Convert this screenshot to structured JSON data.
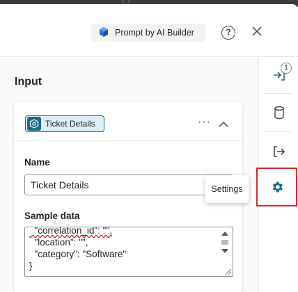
{
  "header": {
    "chip_label": "Prompt by AI Builder",
    "help_label": "?"
  },
  "content": {
    "section_title": "Input",
    "card": {
      "tag_label": "Ticket Details",
      "more_label": "···",
      "name_label": "Name",
      "name_value": "Ticket Details",
      "sample_label": "Sample data",
      "sample_lines": [
        "  \"correlation_id\": \"\",",
        "  \"location\": \"\",",
        "  \"category\": \"Software\"",
        "}"
      ]
    }
  },
  "rail": {
    "badge_count": "1",
    "items": [
      {
        "icon": "input-arrow-icon"
      },
      {
        "icon": "database-icon"
      },
      {
        "icon": "output-arrow-icon"
      },
      {
        "icon": "settings-gear-icon"
      }
    ],
    "tooltip": "Settings"
  },
  "colors": {
    "accent": "#1b6a8a",
    "rail_icon": "#1b6a8a",
    "highlight_box": "#d42a2a"
  }
}
